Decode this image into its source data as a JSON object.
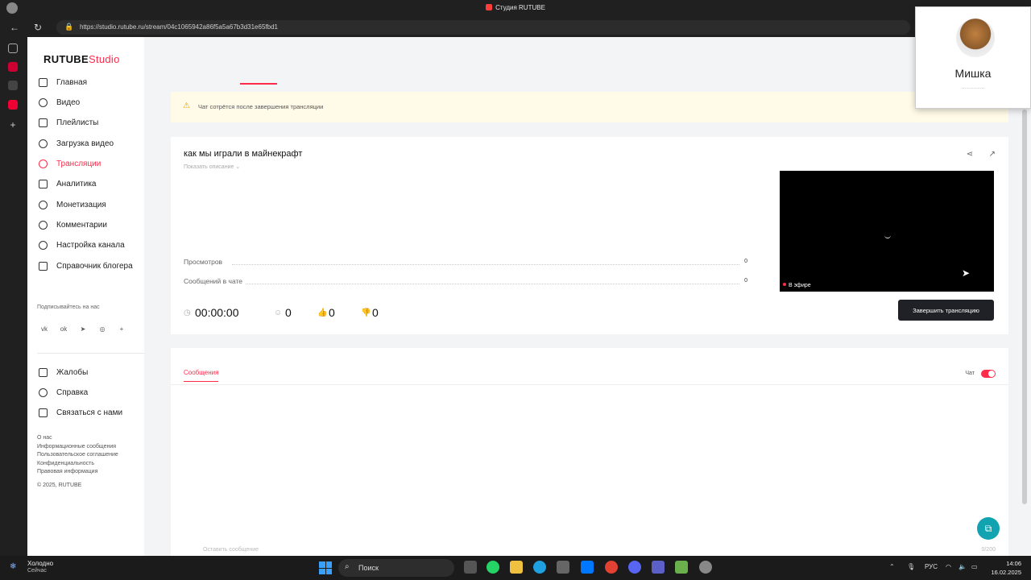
{
  "browser": {
    "window_title": "Студия RUTUBE",
    "url": "https://studio.rutube.ru/stream/04c1065942a86f5a5a67b3d31e65fbd1"
  },
  "sidebar": {
    "logo_main": "RUTUBE",
    "logo_studio": "Studio",
    "items": [
      {
        "label": "Главная",
        "icon": "home-icon"
      },
      {
        "label": "Видео",
        "icon": "video-icon"
      },
      {
        "label": "Плейлисты",
        "icon": "playlist-icon"
      },
      {
        "label": "Загрузка видео",
        "icon": "upload-icon"
      },
      {
        "label": "Трансляции",
        "icon": "broadcast-icon",
        "active": true
      },
      {
        "label": "Аналитика",
        "icon": "analytics-icon"
      },
      {
        "label": "Монетизация",
        "icon": "monetization-icon"
      },
      {
        "label": "Комментарии",
        "icon": "comments-icon"
      },
      {
        "label": "Настройка канала",
        "icon": "settings-icon"
      },
      {
        "label": "Справочник блогера",
        "icon": "book-icon"
      }
    ],
    "subscribe_label": "Подписывайтесь на нас",
    "social": [
      "vk",
      "ok",
      "telegram",
      "viber",
      "+"
    ],
    "secondary_items": [
      {
        "label": "Жалобы",
        "icon": "flag-icon"
      },
      {
        "label": "Справка",
        "icon": "help-icon"
      },
      {
        "label": "Связаться с нами",
        "icon": "mail-icon"
      }
    ],
    "footer_links": [
      "О нас",
      "Информационные сообщения",
      "Пользовательское соглашение",
      "Конфиденциальность",
      "Правовая информация",
      "© 2025, RUTUBE"
    ]
  },
  "alert": {
    "text": "Чат сотрётся после завершения трансляции"
  },
  "stream": {
    "title": "как мы играли в майнекрафт",
    "show_description": "Показать описание",
    "stats": [
      {
        "label": "Просмотров",
        "value": "0"
      },
      {
        "label": "Сообщений в чате",
        "value": "0"
      }
    ],
    "live_label": "В эфире",
    "timer": "00:00:00",
    "viewers": "0",
    "likes": "0",
    "dislikes": "0",
    "end_button": "Завершить трансляцию"
  },
  "chat": {
    "tab": "Сообщения",
    "toggle_label": "Чат",
    "input_placeholder": "Оставить сообщение",
    "counter": "0/200"
  },
  "profile": {
    "name": "Мишка",
    "sub": "..............."
  },
  "taskbar": {
    "weather_title": "Холодно",
    "weather_sub": "Сейчас",
    "search": "Поиск",
    "lang": "РУС",
    "time": "14:06",
    "date": "16.02.2025"
  },
  "colors": {
    "accent": "#ff2b4a",
    "button_dark": "#1f2126",
    "alert_bg": "#fffbe8"
  }
}
